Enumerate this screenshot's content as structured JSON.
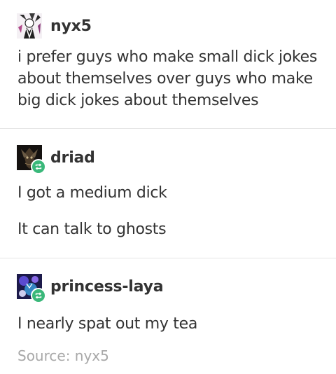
{
  "posts": [
    {
      "username": "nyx5",
      "avatar_icon": "nyx5-avatar-icon",
      "reblogged": false,
      "paragraphs": [
        "i prefer guys who make small dick jokes about themselves over guys who make big dick jokes about themselves"
      ]
    },
    {
      "username": "driad",
      "avatar_icon": "driad-avatar-icon",
      "reblogged": true,
      "paragraphs": [
        "I got a medium dick",
        "It can talk to ghosts"
      ]
    },
    {
      "username": "princess-laya",
      "avatar_icon": "princess-laya-avatar-icon",
      "reblogged": true,
      "paragraphs": [
        "I nearly spat out my tea"
      ]
    }
  ],
  "source": {
    "label": "Source: nyx5"
  },
  "colors": {
    "text": "#333333",
    "source_text": "#a8a8a8",
    "divider": "#e5e5e5",
    "reblog_badge": "#3ab87a"
  }
}
